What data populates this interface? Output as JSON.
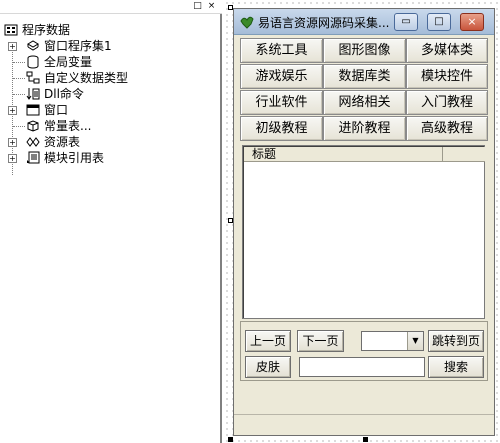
{
  "tree": {
    "root": "程序数据",
    "items": [
      {
        "label": "窗口程序集1"
      },
      {
        "label": "全局变量"
      },
      {
        "label": "自定义数据类型"
      },
      {
        "label": "Dll命令"
      },
      {
        "label": "窗口"
      },
      {
        "label": "常量表..."
      },
      {
        "label": "资源表"
      },
      {
        "label": "模块引用表"
      }
    ]
  },
  "panel_buttons": {
    "restore": "□",
    "close": "×"
  },
  "form": {
    "title": "易语言资源网源码采集...",
    "caption_buttons": {
      "minimize": "▭",
      "maximize": "□",
      "close": "×"
    },
    "categories": [
      "系统工具",
      "图形图像",
      "多媒体类",
      "游戏娱乐",
      "数据库类",
      "模块控件",
      "行业软件",
      "网络相关",
      "入门教程",
      "初级教程",
      "进阶教程",
      "高级教程"
    ],
    "list": {
      "column_title": "标题"
    },
    "controls": {
      "prev_page": "上一页",
      "next_page": "下一页",
      "jump": "跳转到页",
      "skin": "皮肤",
      "search": "搜索",
      "combo_arrow": "▼"
    }
  },
  "colors": {
    "form_bg": "#ece9d8",
    "titlebar": "#a5bcd8",
    "close_button": "#c8553c"
  }
}
